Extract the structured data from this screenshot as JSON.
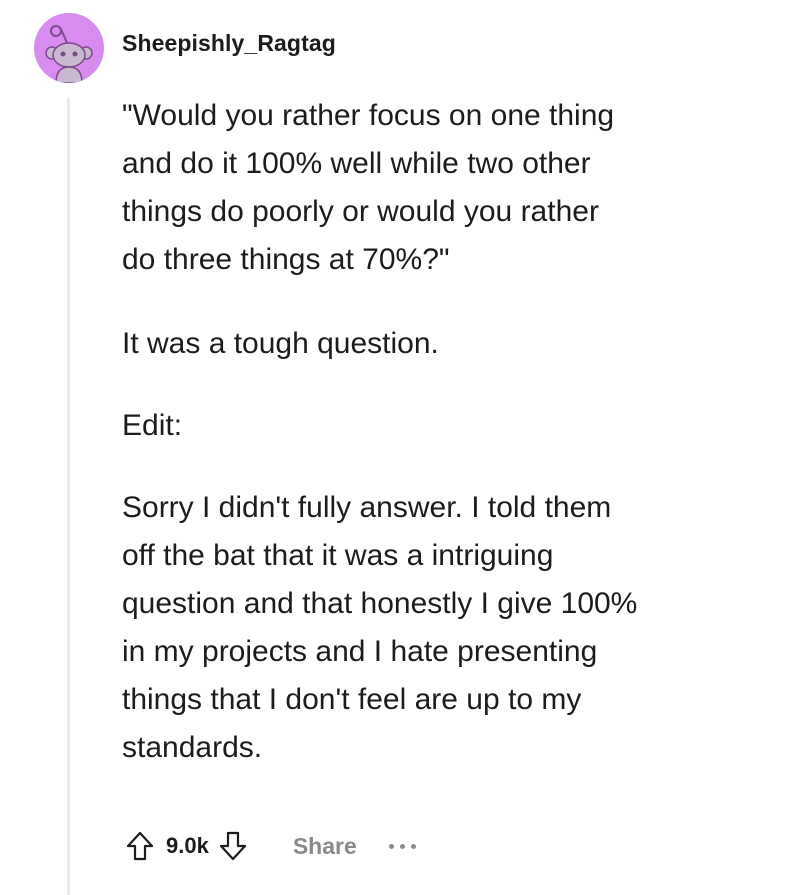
{
  "comment": {
    "author": "Sheepishly_Ragtag",
    "avatar_icon": "snoo-avatar-icon",
    "avatar_color": "#d98cf0",
    "paragraphs": [
      "\"Would you rather focus on one thing\nand do it 100% well while two other\nthings do poorly or would you rather\ndo three things at 70%?\"",
      "It was a tough question.",
      "Edit:",
      "Sorry I didn't fully answer. I told them\noff the bat that it was a intriguing\nquestion and that honestly I give 100%\nin my projects and I hate presenting\nthings that I don't feel are up to my\nstandards."
    ]
  },
  "actions": {
    "upvote_icon": "upvote-arrow-icon",
    "score": "9.0k",
    "downvote_icon": "downvote-arrow-icon",
    "share_label": "Share",
    "more_icon": "more-options-icon"
  }
}
